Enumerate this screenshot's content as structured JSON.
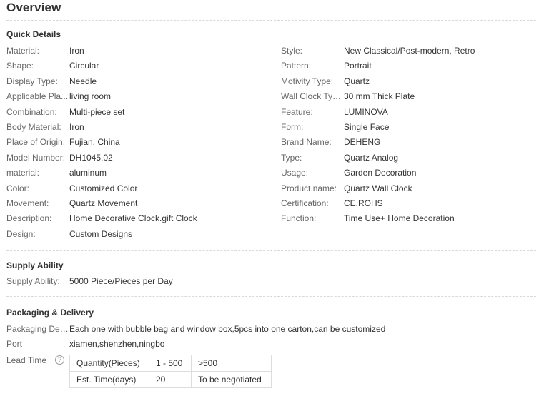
{
  "overview_title": "Overview",
  "quick_details": {
    "title": "Quick Details",
    "left": [
      {
        "label": "Material:",
        "value": "Iron"
      },
      {
        "label": "Shape:",
        "value": "Circular"
      },
      {
        "label": "Display Type:",
        "value": "Needle"
      },
      {
        "label": "Applicable Pla...",
        "value": "living room"
      },
      {
        "label": "Combination:",
        "value": "Multi-piece set"
      },
      {
        "label": "Body Material:",
        "value": "Iron"
      },
      {
        "label": "Place of Origin:",
        "value": "Fujian, China"
      },
      {
        "label": "Model Number:",
        "value": "DH1045.02"
      },
      {
        "label": "material:",
        "value": "aluminum"
      },
      {
        "label": "Color:",
        "value": "Customized Color"
      },
      {
        "label": "Movement:",
        "value": "Quartz Movement"
      },
      {
        "label": "Description:",
        "value": "Home Decorative Clock.gift Clock"
      },
      {
        "label": "Design:",
        "value": "Custom Designs"
      }
    ],
    "right": [
      {
        "label": "Style:",
        "value": "New Classical/Post-modern, Retro"
      },
      {
        "label": "Pattern:",
        "value": "Portrait"
      },
      {
        "label": "Motivity Type:",
        "value": "Quartz"
      },
      {
        "label": "Wall Clock Type:",
        "value": "30 mm Thick Plate"
      },
      {
        "label": "Feature:",
        "value": "LUMINOVA"
      },
      {
        "label": "Form:",
        "value": "Single Face"
      },
      {
        "label": "Brand Name:",
        "value": "DEHENG"
      },
      {
        "label": "Type:",
        "value": "Quartz Analog"
      },
      {
        "label": "Usage:",
        "value": "Garden Decoration"
      },
      {
        "label": "Product name:",
        "value": "Quartz Wall Clock"
      },
      {
        "label": "Certification:",
        "value": "CE.ROHS"
      },
      {
        "label": "Function:",
        "value": "Time Use+ Home Decoration"
      }
    ]
  },
  "supply_ability": {
    "title": "Supply Ability",
    "label": "Supply Ability:",
    "value": "5000 Piece/Pieces per Day"
  },
  "packaging": {
    "title": "Packaging & Delivery",
    "details_label": "Packaging Det...",
    "details_value": "Each one with bubble bag and window box,5pcs into one carton,can be customized",
    "port_label": "Port",
    "port_value": "xiamen,shenzhen,ningbo",
    "lead_time_label": "Lead Time",
    "help_icon_glyph": "?",
    "lead_table": [
      [
        "Quantity(Pieces)",
        "1 - 500",
        ">500"
      ],
      [
        "Est. Time(days)",
        "20",
        "To be negotiated"
      ]
    ]
  }
}
